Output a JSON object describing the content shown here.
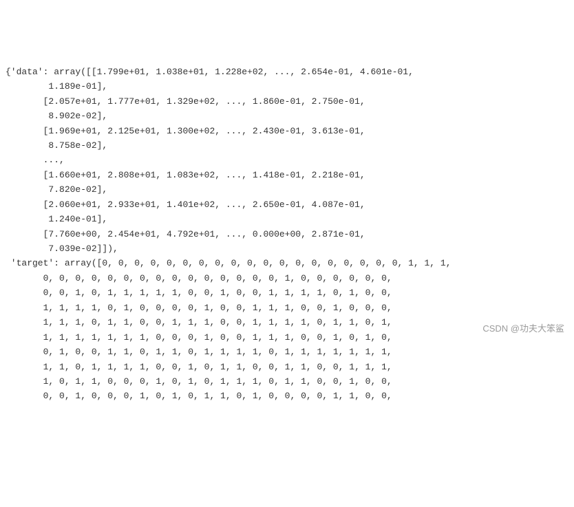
{
  "output": {
    "lines": [
      "{'data': array([[1.799e+01, 1.038e+01, 1.228e+02, ..., 2.654e-01, 4.601e-01,",
      "        1.189e-01],",
      "       [2.057e+01, 1.777e+01, 1.329e+02, ..., 1.860e-01, 2.750e-01,",
      "        8.902e-02],",
      "       [1.969e+01, 2.125e+01, 1.300e+02, ..., 2.430e-01, 3.613e-01,",
      "        8.758e-02],",
      "       ...,",
      "       [1.660e+01, 2.808e+01, 1.083e+02, ..., 1.418e-01, 2.218e-01,",
      "        7.820e-02],",
      "       [2.060e+01, 2.933e+01, 1.401e+02, ..., 2.650e-01, 4.087e-01,",
      "        1.240e-01],",
      "       [7.760e+00, 2.454e+01, 4.792e+01, ..., 0.000e+00, 2.871e-01,",
      "        7.039e-02]]),",
      " 'target': array([0, 0, 0, 0, 0, 0, 0, 0, 0, 0, 0, 0, 0, 0, 0, 0, 0, 0, 0, 1, 1, 1,",
      "       0, 0, 0, 0, 0, 0, 0, 0, 0, 0, 0, 0, 0, 0, 0, 1, 0, 0, 0, 0, 0, 0,",
      "       0, 0, 1, 0, 1, 1, 1, 1, 1, 0, 0, 1, 0, 0, 1, 1, 1, 1, 0, 1, 0, 0,",
      "       1, 1, 1, 1, 0, 1, 0, 0, 0, 0, 1, 0, 0, 1, 1, 1, 0, 0, 1, 0, 0, 0,",
      "       1, 1, 1, 0, 1, 1, 0, 0, 1, 1, 1, 0, 0, 1, 1, 1, 1, 0, 1, 1, 0, 1,",
      "       1, 1, 1, 1, 1, 1, 1, 0, 0, 0, 1, 0, 0, 1, 1, 1, 0, 0, 1, 0, 1, 0,",
      "       0, 1, 0, 0, 1, 1, 0, 1, 1, 0, 1, 1, 1, 1, 0, 1, 1, 1, 1, 1, 1, 1,",
      "       1, 1, 0, 1, 1, 1, 1, 0, 0, 1, 0, 1, 1, 0, 0, 1, 1, 0, 0, 1, 1, 1,",
      "       1, 0, 1, 1, 0, 0, 0, 1, 0, 1, 0, 1, 1, 1, 0, 1, 1, 0, 0, 1, 0, 0,",
      "       0, 0, 1, 0, 0, 0, 1, 0, 1, 0, 1, 1, 0, 1, 0, 0, 0, 0, 1, 1, 0, 0,"
    ]
  },
  "watermark": "CSDN @功夫大笨鲨"
}
